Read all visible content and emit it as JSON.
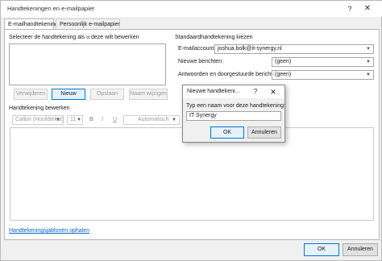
{
  "window": {
    "title": "Handtekeningen en e-mailpapier",
    "help_icon": "?",
    "close_icon": "✕"
  },
  "tabs": [
    {
      "label": "E-mailhandtekening",
      "active": true
    },
    {
      "label": "Persoonlijk e-mailpapier",
      "active": false
    }
  ],
  "left": {
    "select_label": "Selecteer de handtekening als u deze wilt bewerken",
    "buttons": {
      "remove": "Verwijderen",
      "new": "Nieuw",
      "save": "Opslaan",
      "rename": "Naam wijzigen"
    }
  },
  "right": {
    "section_label": "Standaardhandtekening kiezen",
    "account_label": "E-mailaccount:",
    "account_value": "joshua.bolk@it-synergy.nl",
    "new_messages_label": "Nieuwe berichten:",
    "new_messages_value": "(geen)",
    "replies_label": "Antwoorden en doorgestuurde berichten:",
    "replies_value": "(geen)"
  },
  "editor": {
    "section_label": "Handtekening bewerken",
    "font": "Calibri (Hoofdtekst)",
    "size": "11",
    "bold": "B",
    "italic": "I",
    "underline": "U",
    "color": "Automatisch"
  },
  "templates_link": "Handtekeningsjablonen ophalen",
  "footer": {
    "ok": "OK",
    "cancel": "Annuleren"
  },
  "dialog": {
    "title": "Nieuwe handtekeni...",
    "help_icon": "?",
    "close_icon": "✕",
    "prompt": "Typ een naam voor deze handtekening:",
    "value": "IT Synergy",
    "ok": "OK",
    "cancel": "Annuleren"
  }
}
